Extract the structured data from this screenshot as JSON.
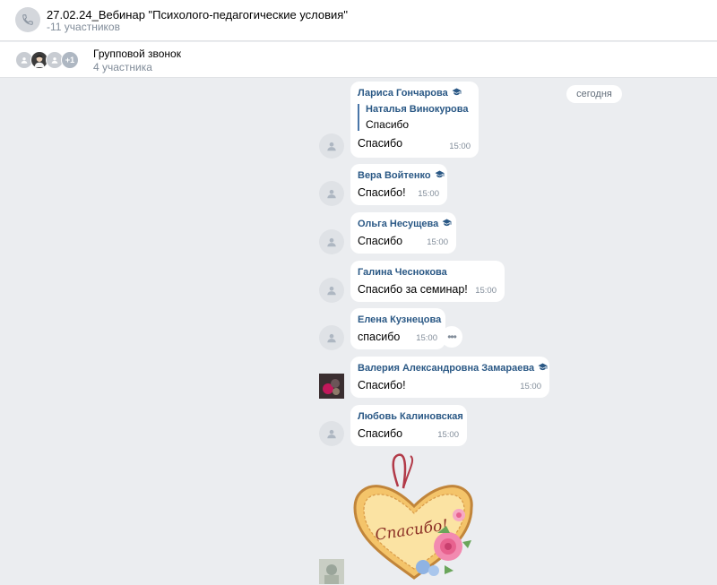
{
  "header": {
    "title": "27.02.24_Вебинар \"Психолого-педагогические условия\"",
    "subtitle": "-11 участников",
    "icon": "phone-icon"
  },
  "call": {
    "label": "Групповой звонок",
    "count": "4 участника",
    "more": "+1"
  },
  "day_badge": "сегодня",
  "messages": [
    {
      "name": "Лариса Гончарова",
      "verified": true,
      "reply_name": "Наталья Винокурова",
      "reply_text": "Спасибо",
      "text": "Спасибо",
      "time": "15:00"
    },
    {
      "name": "Вера Войтенко",
      "verified": true,
      "text": "Спасибо!",
      "time": "15:00"
    },
    {
      "name": "Ольга Несущева",
      "verified": true,
      "text": "Спасибо",
      "time": "15:00"
    },
    {
      "name": "Галина Чеснокова",
      "verified": false,
      "text": "Спасибо за семинар!",
      "time": "15:00"
    },
    {
      "name": "Елена Кузнецова",
      "verified": false,
      "text": "спасибо",
      "time": "15:00"
    },
    {
      "name": "Валерия Александровна Замараева",
      "verified": true,
      "text": "Спасибо!",
      "time": "15:00"
    },
    {
      "name": "Любовь Калиновская",
      "verified": false,
      "text": "Спасибо",
      "time": "15:00"
    }
  ],
  "sticker": {
    "text": "Спасибо!",
    "icon": "heart-thanks-sticker"
  },
  "colors": {
    "accent": "#2a5885",
    "background": "#ebedf0"
  }
}
